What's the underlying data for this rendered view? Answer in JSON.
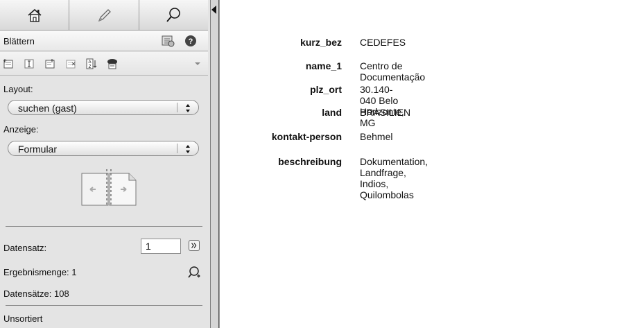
{
  "tabs": [
    {
      "icon": "home-icon"
    },
    {
      "icon": "pencil-icon"
    },
    {
      "icon": "search-icon"
    }
  ],
  "sidebar": {
    "section_title": "Blättern",
    "layout_label": "Layout:",
    "layout_value": "suchen (gast)",
    "view_label": "Anzeige:",
    "view_value": "Formular",
    "record_label": "Datensatz:",
    "record_value": "1",
    "found_label": "Ergebnismenge: 1",
    "total_label": "Datensätze: 108",
    "sort_label": "Unsortiert"
  },
  "record": {
    "fields": [
      {
        "key": "kurz_bez",
        "value": "CEDEFES"
      },
      {
        "key": "name_1",
        "value": "Centro de Documentação"
      },
      {
        "key": "plz_ort",
        "value": "30.140-040 Belo Horizonte, MG"
      },
      {
        "key": "land",
        "value": "BRASILIEN"
      },
      {
        "key": "kontakt-person",
        "value": "Behmel"
      },
      {
        "key": "beschreibung",
        "value": "Dokumentation, Landfrage, Indios, Quilombolas"
      }
    ]
  }
}
